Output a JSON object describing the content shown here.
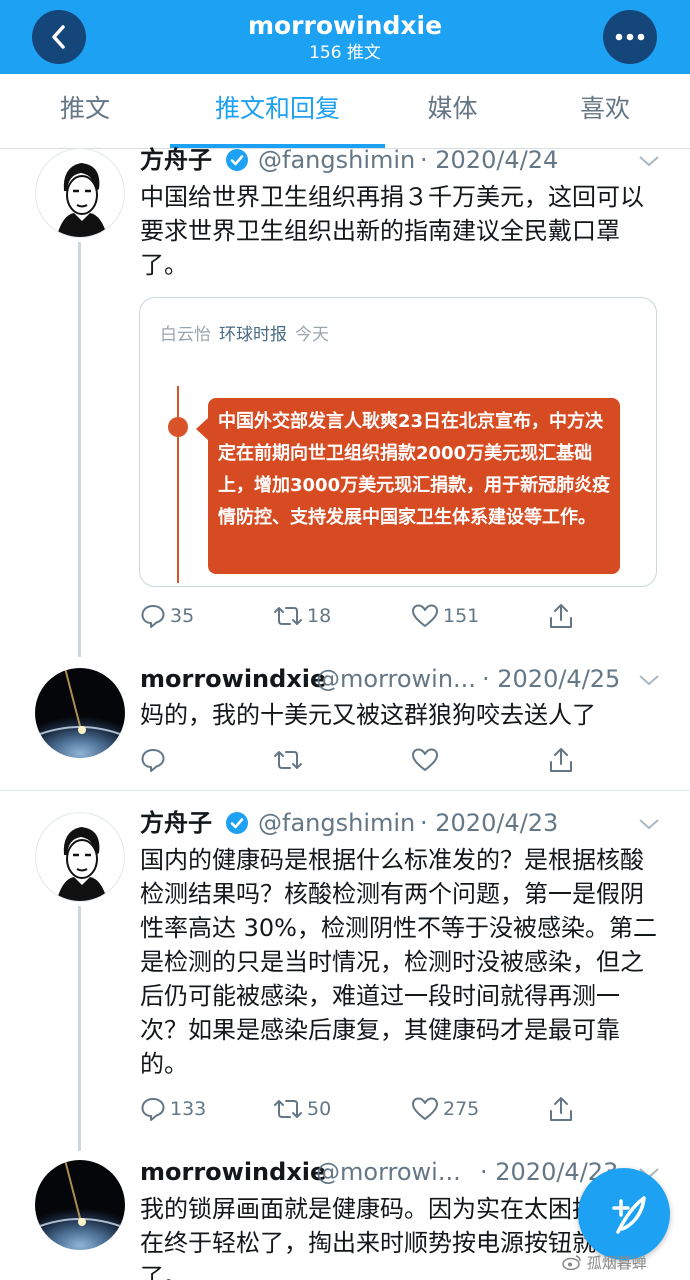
{
  "header": {
    "title": "morrowindxie",
    "subtitle": "156 推文"
  },
  "tabs": [
    "推文",
    "推文和回复",
    "媒体",
    "喜欢"
  ],
  "tweets": [
    {
      "name": "方舟子",
      "handle": "@fangshimin",
      "date": "· 2020/4/24",
      "text": "中国给世界卫生组织再捐３千万美元，这回可以要求世界卫生组织出新的指南建议全民戴口罩了。",
      "replies": "35",
      "retweets": "18",
      "likes": "151"
    },
    {
      "name": "morrowindxie",
      "handle": "@morrowin...",
      "date": "· 2020/4/25",
      "text": "妈的，我的十美元又被这群狼狗咬去送人了"
    },
    {
      "name": "方舟子",
      "handle": "@fangshimin",
      "date": "· 2020/4/23",
      "text": "国内的健康码是根据什么标准发的？是根据核酸检测结果吗？核酸检测有两个问题，第一是假阴性率高达 30%，检测阴性不等于没被感染。第二是检测的只是当时情况，检测时没被感染，但之后仍可能被感染，难道过一段时间就得再测一次？如果是感染后康复，其健康码才是最可靠的。",
      "replies": "133",
      "retweets": "50",
      "likes": "275"
    },
    {
      "name": "morrowindxie",
      "handle": "@morrowi...",
      "date": "· 2020/4/23",
      "text": "我的锁屏画面就是健康码。因为实在太困扰，现在终于轻松了，掏出来时顺势按电源按钮就可以了。"
    }
  ],
  "card": {
    "author": "白云怡",
    "source": "环球时报",
    "time": "今天",
    "text": "中国外交部发言人耿爽23日在北京宣布，中方决定在前期向世卫组织捐款2000万美元现汇基础上，增加3000万美元现汇捐款，用于新冠肺炎疫情防控、支持发展中国家卫生体系建设等工作。"
  },
  "watermark": "孤烟暮蝉",
  "colors": {
    "accent": "#1da1f2",
    "header_button": "#15467a",
    "card_red": "#d74b23",
    "text": "#14171a",
    "muted": "#657786"
  }
}
